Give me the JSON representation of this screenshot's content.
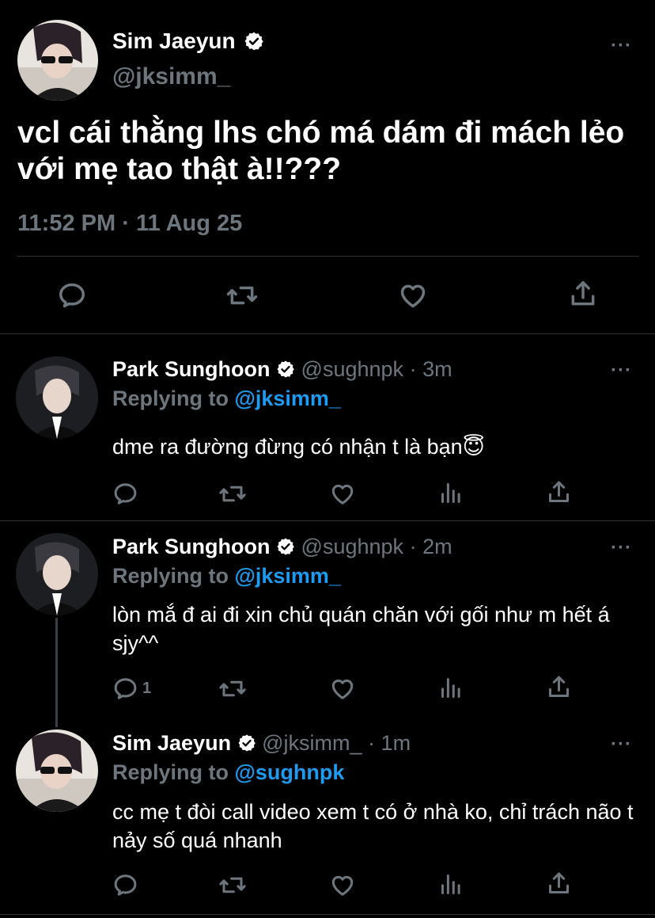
{
  "main_tweet": {
    "name": "Sim Jaeyun",
    "handle": "@jksimm_",
    "text": "vcl cái thằng lhs chó má dám đi mách lẻo với mẹ tao thật à!!???",
    "time": "11:52 PM",
    "separator": "·",
    "date": "11 Aug 25",
    "more": "···"
  },
  "replies": [
    {
      "name": "Park Sunghoon",
      "handle": "@sughnpk",
      "separator": "·",
      "age": "3m",
      "replying_label": "Replying to",
      "replying_to": "@jksimm_",
      "text": "dme ra đường đừng có nhận t là bạn😇",
      "reply_count": "",
      "more": "···"
    },
    {
      "name": "Park Sunghoon",
      "handle": "@sughnpk",
      "separator": "·",
      "age": "2m",
      "replying_label": "Replying to",
      "replying_to": "@jksimm_",
      "text": "lòn mắ đ ai đi xin chủ quán chăn với gối như m hết á sjy^^",
      "reply_count": "1",
      "more": "···"
    },
    {
      "name": "Sim Jaeyun",
      "handle": "@jksimm_",
      "separator": "·",
      "age": "1m",
      "replying_label": "Replying to",
      "replying_to": "@sughnpk",
      "text": "cc mẹ t đòi call video xem t có ở nhà ko, chỉ trách não t nảy số quá nhanh",
      "reply_count": "",
      "more": "···"
    }
  ],
  "colors": {
    "background": "#000000",
    "text": "#ffffff",
    "muted": "#6e767d",
    "link": "#1d9bf0",
    "divider": "#2f3336"
  },
  "icons": [
    "verified-badge-icon",
    "reply-icon",
    "retweet-icon",
    "like-icon",
    "analytics-icon",
    "share-icon",
    "more-icon"
  ]
}
